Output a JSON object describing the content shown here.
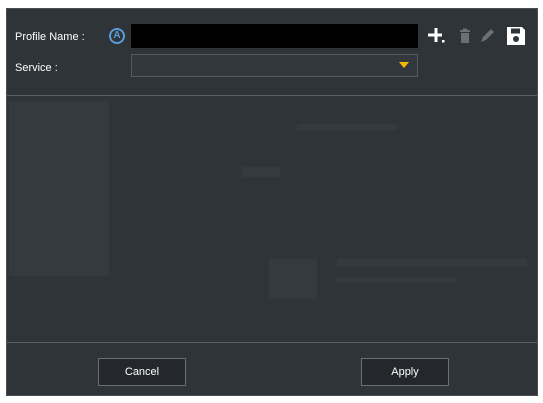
{
  "dialog": {
    "profile_name_label": "Profile Name :",
    "auto_icon_letter": "A",
    "profile_name_value": "",
    "service_label": "Service :",
    "service_value": ""
  },
  "toolbar": {
    "icons": [
      "plus-icon",
      "trash-icon",
      "pencil-icon",
      "save-icon"
    ]
  },
  "footer": {
    "cancel_label": "Cancel",
    "apply_label": "Apply"
  },
  "colors": {
    "background": "#2f3439",
    "input_background": "#000000",
    "accent_blue": "#5b9bd8",
    "dropdown_arrow": "#f5b800",
    "text": "#ffffff"
  }
}
